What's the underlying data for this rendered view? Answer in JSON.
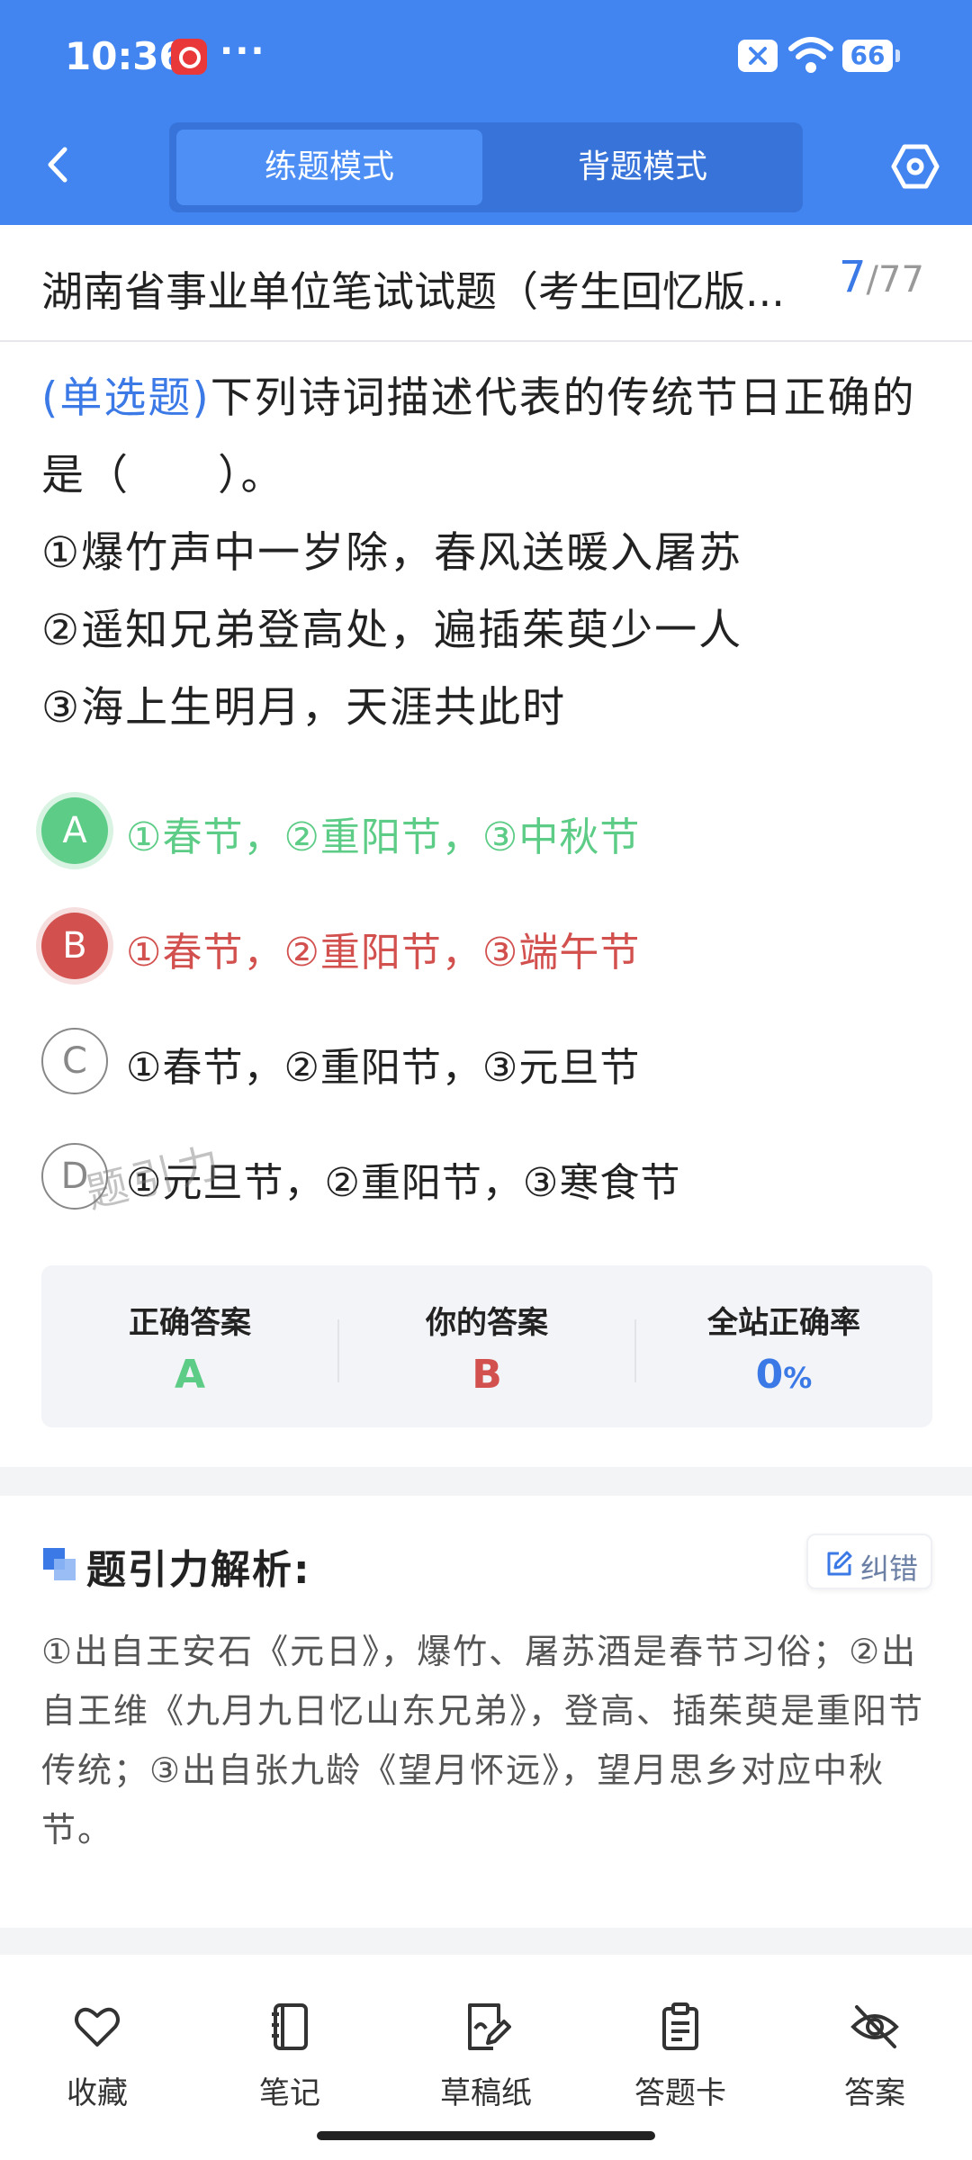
{
  "status_bar": {
    "time": "10:36",
    "dots": "···",
    "battery": "66"
  },
  "header": {
    "modes": [
      {
        "label": "练题模式",
        "active": true
      },
      {
        "label": "背题模式",
        "active": false
      }
    ]
  },
  "paper": {
    "title": "湖南省事业单位笔试试题（考生回忆版...",
    "current": "7",
    "separator": "/",
    "total": "77"
  },
  "question": {
    "type_label": "(单选题)",
    "stem_1": "下列诗词描述代表的传统节日正确的",
    "stem_2": "是（　　）。",
    "lines": [
      "①爆竹声中一岁除，春风送暖入屠苏",
      "②遥知兄弟登高处，遍插茱萸少一人",
      "③海上生明月，天涯共此时"
    ]
  },
  "options": [
    {
      "letter": "A",
      "text": "①春节，②重阳节，③中秋节",
      "state": "correct"
    },
    {
      "letter": "B",
      "text": "①春节，②重阳节，③端午节",
      "state": "wrong"
    },
    {
      "letter": "C",
      "text": "①春节，②重阳节，③元旦节",
      "state": "none"
    },
    {
      "letter": "D",
      "text": "①元旦节，②重阳节，③寒食节",
      "state": "none"
    }
  ],
  "watermark": "题引力",
  "answer_summary": {
    "correct_label": "正确答案",
    "correct_value": "A",
    "yours_label": "你的答案",
    "yours_value": "B",
    "rate_label": "全站正确率",
    "rate_value": "0",
    "rate_unit": "%"
  },
  "analysis": {
    "title": "题引力解析:",
    "report_label": "纠错",
    "text": "①出自王安石《元日》，爆竹、屠苏酒是春节习俗；②出自王维《九月九日忆山东兄弟》，登高、插茱萸是重阳节传统；③出自张九龄《望月怀远》，望月思乡对应中秋节。"
  },
  "toolbar": [
    {
      "label": "收藏",
      "icon": "heart-icon"
    },
    {
      "label": "笔记",
      "icon": "notebook-icon"
    },
    {
      "label": "草稿纸",
      "icon": "draft-icon"
    },
    {
      "label": "答题卡",
      "icon": "answer-sheet-icon"
    },
    {
      "label": "答案",
      "icon": "eye-off-icon"
    }
  ],
  "colors": {
    "brand": "#4285f1",
    "correct": "#5ccc86",
    "wrong": "#d2504e",
    "accent": "#3b79e6"
  }
}
